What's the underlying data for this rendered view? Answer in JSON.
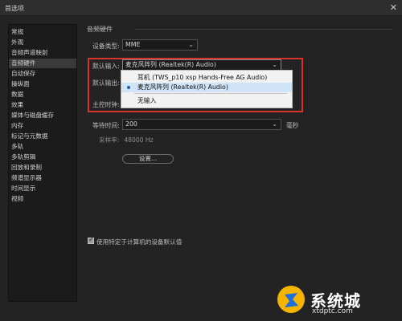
{
  "window": {
    "title": "首选项",
    "close_glyph": "✕"
  },
  "sidebar": {
    "items": [
      {
        "label": "常规"
      },
      {
        "label": "外观"
      },
      {
        "label": "音频声道映射"
      },
      {
        "label": "音频硬件",
        "selected": true
      },
      {
        "label": "自动保存"
      },
      {
        "label": "操纵面"
      },
      {
        "label": "数据"
      },
      {
        "label": "效果"
      },
      {
        "label": "媒体与磁盘缓存"
      },
      {
        "label": "内存"
      },
      {
        "label": "标记与元数据"
      },
      {
        "label": "多轨"
      },
      {
        "label": "多轨剪辑"
      },
      {
        "label": "回放和录制"
      },
      {
        "label": "频谱显示器"
      },
      {
        "label": "时间显示"
      },
      {
        "label": "视频"
      }
    ]
  },
  "audio_hardware": {
    "section_title": "音频硬件",
    "device_type": {
      "label": "设备类型:",
      "value": "MME"
    },
    "default_input": {
      "label": "默认输入:",
      "value": "麦克风阵列 (Realtek(R) Audio)"
    },
    "default_output": {
      "label": "默认输出:"
    },
    "master_clock": {
      "label": "主控时钟:"
    },
    "latency": {
      "label": "等待时间:",
      "value": "200",
      "unit": "毫秒"
    },
    "sample_rate": {
      "label": "采样率:",
      "value": "48000 Hz"
    },
    "settings_button": "设置...",
    "use_computer_defaults": {
      "label": "使用特定于计算机的设备默认值",
      "checked": true
    }
  },
  "input_dropdown_options": [
    {
      "label": "耳机 (TWS_p10 xsp Hands-Free AG Audio)",
      "selected": false
    },
    {
      "label": "麦克风阵列 (Realtek(R) Audio)",
      "selected": true
    },
    {
      "label": "无输入",
      "selected": false
    }
  ],
  "watermark": {
    "name": "系统城",
    "url": "xtdptc.com"
  },
  "colors": {
    "highlight_border": "#d8352a",
    "option_hover": "#cfe4f7",
    "background": "#232323"
  },
  "icons": {
    "close": "close-icon",
    "caret": "chevron-down-icon",
    "selected_marker": "radio-dot-icon"
  }
}
